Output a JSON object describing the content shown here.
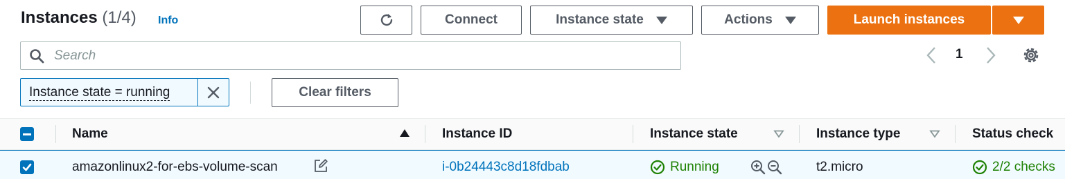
{
  "header": {
    "title": "Instances",
    "count": "(1/4)",
    "info_label": "Info"
  },
  "toolbar": {
    "refresh_icon": "refresh-icon",
    "connect_label": "Connect",
    "instance_state_label": "Instance state",
    "actions_label": "Actions",
    "launch_label": "Launch instances"
  },
  "search": {
    "placeholder": "Search",
    "value": ""
  },
  "pagination": {
    "current_page": "1"
  },
  "filter": {
    "token_label": "Instance state = running",
    "clear_label": "Clear filters"
  },
  "table": {
    "columns": [
      "Name",
      "Instance ID",
      "Instance state",
      "Instance type",
      "Status check"
    ],
    "rows": [
      {
        "selected": true,
        "name": "amazonlinux2-for-ebs-volume-scan",
        "instance_id": "i-0b24443c8d18fdbab",
        "state": "Running",
        "type": "t2.micro",
        "status_check": "2/2 checks"
      }
    ]
  },
  "colors": {
    "primary": "#ec7211",
    "link": "#0073bb",
    "success": "#1d8102"
  }
}
